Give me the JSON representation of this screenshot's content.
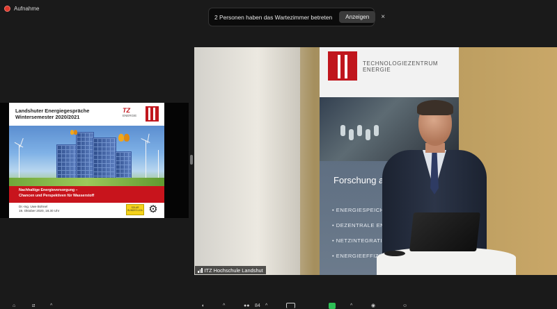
{
  "recording": {
    "label": "Aufnahme",
    "icon": "record-icon"
  },
  "notification": {
    "text": "2 Personen haben das Wartezimmer betreten",
    "button_label": "Anzeigen",
    "close_glyph": "×"
  },
  "shared_slide": {
    "title_line1": "Landshuter Energiegespräche",
    "title_line2": "Wintersemester 2020/2021",
    "logo_itz": "TZ",
    "logo_itz_sub": "ENERGIE",
    "subtitle_line1": "Nachhaltige Energieversorgung –",
    "subtitle_line2": "Chancen und Perspektiven für Wasserstoff",
    "speaker": "Dr.-Ing. Uwe Bohnel",
    "date": "19. Oktober 2020, 18.30 Uhr",
    "badge_text": "SOLAR BUNDES LIGA"
  },
  "video": {
    "participant_name": "ITZ Hochschule Landshut",
    "banner": {
      "org_line1": "TECHNOLOGIEZENTRUM",
      "org_line2": "ENERGIE",
      "heading": "Forschung am",
      "items": [
        "ENERGIESPEICHER",
        "DEZENTRALE ENERGIE",
        "NETZINTEGRATION",
        "ENERGIEEFFIZIEN"
      ]
    }
  },
  "toolbar": {
    "participants_count": "84"
  },
  "colors": {
    "recording": "#e0392c",
    "brand_red": "#c0161d",
    "active_green": "#2dbf55"
  }
}
